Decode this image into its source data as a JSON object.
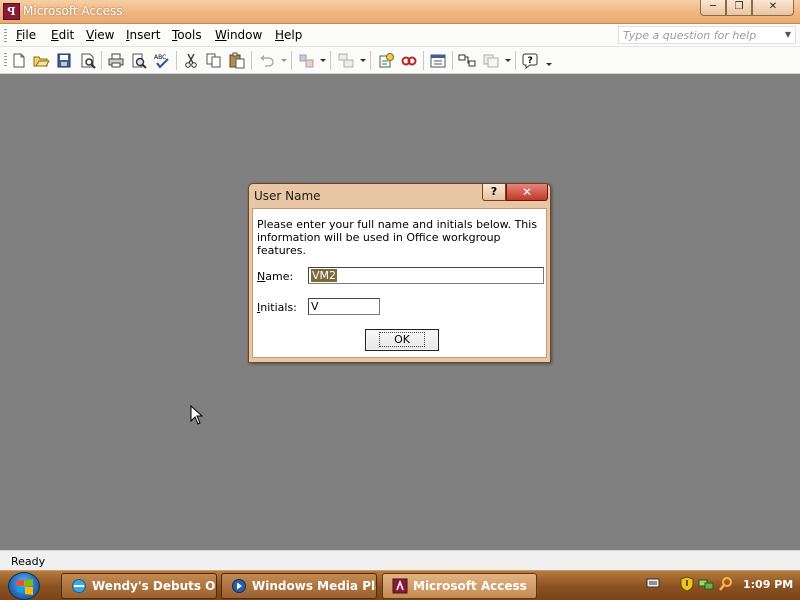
{
  "window": {
    "title": "Microsoft Access",
    "controls": {
      "minimize": "─",
      "restore": "❐",
      "close": "✕"
    }
  },
  "menubar": {
    "items": [
      {
        "label": "File",
        "underline": "F",
        "rest": "ile"
      },
      {
        "label": "Edit",
        "underline": "E",
        "rest": "dit"
      },
      {
        "label": "View",
        "underline": "V",
        "rest": "iew"
      },
      {
        "label": "Insert",
        "underline": "I",
        "rest": "nsert"
      },
      {
        "label": "Tools",
        "underline": "T",
        "rest": "ools"
      },
      {
        "label": "Window",
        "underline": "W",
        "rest": "indow"
      },
      {
        "label": "Help",
        "underline": "H",
        "rest": "elp"
      }
    ],
    "help_placeholder": "Type a question for help"
  },
  "toolbar": {
    "buttons": [
      "new-icon",
      "open-icon",
      "save-icon",
      "file-search-icon",
      "print-icon",
      "print-preview-icon",
      "spelling-icon",
      "cut-icon",
      "copy-icon",
      "paste-icon",
      "undo-icon",
      "office-links-icon",
      "analyze-icon",
      "code-icon",
      "script-editor-icon",
      "properties-icon",
      "relationships-icon",
      "new-object-icon",
      "help-icon"
    ]
  },
  "dialog": {
    "title": "User Name",
    "help_glyph": "?",
    "close_glyph": "✕",
    "message": "Please enter your full name and initials below.  This information will be used in Office workgroup features.",
    "name_label_u": "N",
    "name_label_rest": "ame:",
    "name_value": "VM2",
    "initials_label_u": "I",
    "initials_label_rest": "nitials:",
    "initials_value": "V",
    "ok_label": "OK"
  },
  "statusbar": {
    "text": "Ready"
  },
  "taskbar": {
    "tasks": [
      {
        "label": "Wendy's Debuts Or...",
        "active": false
      },
      {
        "label": "Windows Media Pla...",
        "active": false
      },
      {
        "label": "Microsoft Access",
        "active": true
      }
    ],
    "clock": "1:09 PM"
  },
  "colors": {
    "titlebar": "#efba86",
    "workspace": "#808080",
    "taskbar": "#8a5121",
    "selection": "#7d6a3c"
  }
}
